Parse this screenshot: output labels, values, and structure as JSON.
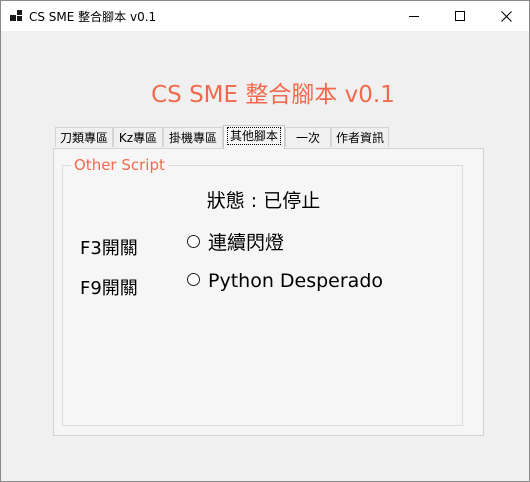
{
  "window": {
    "title": "CS SME 整合腳本 v0.1"
  },
  "heading": "CS SME  整合腳本 v0.1",
  "tabs": [
    {
      "label": "刀類專區",
      "active": false
    },
    {
      "label": "Kz專區",
      "active": false
    },
    {
      "label": "掛機專區",
      "active": false
    },
    {
      "label": "其他腳本",
      "active": true
    },
    {
      "label": "一次",
      "active": false
    },
    {
      "label": "作者資訊",
      "active": false
    }
  ],
  "group": {
    "title": "Other Script",
    "status": "狀態 : 已停止",
    "hotkeys": [
      {
        "label": "F3開關",
        "option": "連續閃燈",
        "checked": false
      },
      {
        "label": "F9開關",
        "option": "Python Desperado",
        "checked": false
      }
    ]
  },
  "colors": {
    "accent": "#f26a4d"
  }
}
